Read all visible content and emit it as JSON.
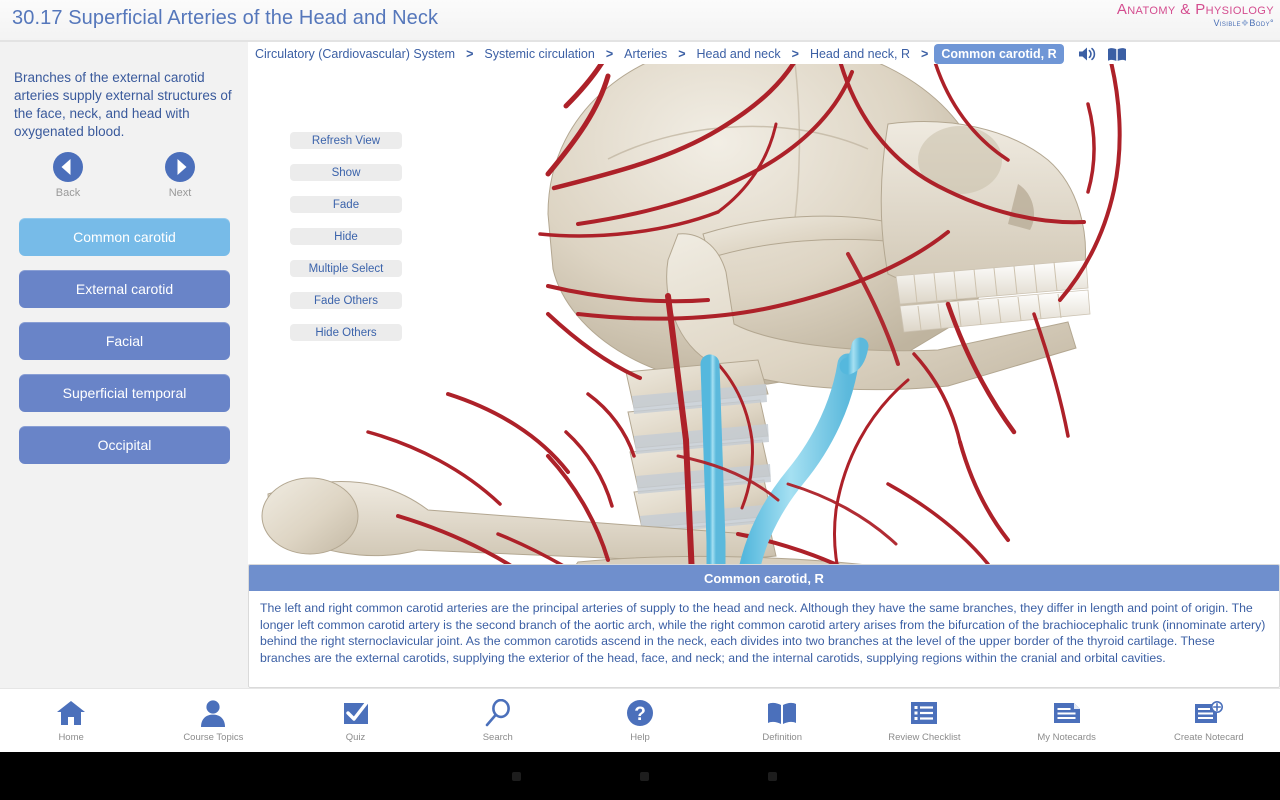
{
  "header": {
    "title": "30.17 Superficial Arteries of the Head and Neck",
    "logo_line1": "Anatomy & Physiology",
    "logo_line2_left": "Visible",
    "logo_line2_sep": "❖",
    "logo_line2_right": "Body°"
  },
  "sidebar": {
    "description": "Branches of the external carotid arteries supply external structures of the face, neck, and head with oxygenated blood.",
    "back_label": "Back",
    "next_label": "Next",
    "structures": [
      {
        "label": "Common carotid",
        "active": true
      },
      {
        "label": "External carotid",
        "active": false
      },
      {
        "label": "Facial",
        "active": false
      },
      {
        "label": "Superficial temporal",
        "active": false
      },
      {
        "label": "Occipital",
        "active": false
      }
    ]
  },
  "breadcrumb": {
    "items": [
      {
        "label": "Circulatory (Cardiovascular) System",
        "active": false
      },
      {
        "label": "Systemic circulation",
        "active": false
      },
      {
        "label": "Arteries",
        "active": false
      },
      {
        "label": "Head and neck",
        "active": false
      },
      {
        "label": "Head and neck, R",
        "active": false
      },
      {
        "label": "Common carotid, R",
        "active": true
      }
    ],
    "separator": ">",
    "audio_icon": "speaker-icon",
    "definition_icon": "book-icon"
  },
  "viewport": {
    "controls": [
      "Refresh View",
      "Show",
      "Fade",
      "Hide",
      "Multiple Select",
      "Fade Others",
      "Hide Others"
    ],
    "model_description": "3D skeletal head and neck with red arteries and highlighted cyan common carotid artery"
  },
  "info_panel": {
    "title": "Common carotid, R",
    "body": "The left and right common carotid arteries are the principal arteries of supply to the head and neck. Although they have the same branches, they differ in length and point of origin. The longer left common carotid artery is the second branch of the aortic arch, while the right common carotid artery arises from the bifurcation of the brachiocephalic trunk (innominate artery) behind the right sternoclavicular joint. As the common carotids ascend in the neck, each divides into two branches at the level of the upper border of the thyroid cartilage. These branches are the external carotids, supplying the exterior of the head, face, and neck; and the internal carotids, supplying regions within the cranial and orbital cavities."
  },
  "toolbar": {
    "items": [
      {
        "label": "Home",
        "icon": "home-icon"
      },
      {
        "label": "Course Topics",
        "icon": "person-icon"
      },
      {
        "label": "Quiz",
        "icon": "checkmark-square-icon"
      },
      {
        "label": "Search",
        "icon": "magnifier-icon"
      },
      {
        "label": "Help",
        "icon": "question-circle-icon"
      },
      {
        "label": "Definition",
        "icon": "open-book-icon"
      },
      {
        "label": "Review Checklist",
        "icon": "list-icon"
      },
      {
        "label": "My Notecards",
        "icon": "notecard-icon"
      },
      {
        "label": "Create Notecard",
        "icon": "notecard-plus-icon"
      }
    ]
  },
  "system_nav": {
    "back": "back-button",
    "home": "home-button",
    "recents": "recents-button"
  },
  "colors": {
    "accent_blue": "#4b6fbb",
    "active_item": "#77bbe8",
    "item": "#6984c8",
    "brand_pink": "#d44d8f",
    "artery_red": "#b2212b",
    "highlight_cyan": "#7fd0e8",
    "bone": "#ded5c6"
  }
}
